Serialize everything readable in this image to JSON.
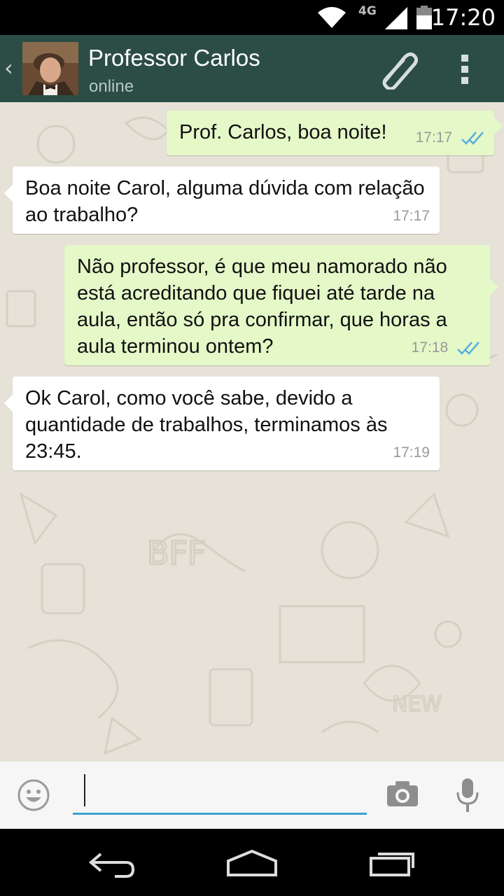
{
  "status_bar": {
    "network": "4G",
    "time": "17:20"
  },
  "header": {
    "back_icon": "chevron-left-icon",
    "contact_name": "Professor Carlos",
    "contact_status": "online",
    "attach_icon": "paperclip-icon",
    "menu_icon": "overflow-menu-icon"
  },
  "messages": [
    {
      "direction": "out",
      "text": "Prof. Carlos, boa noite!",
      "time": "17:17",
      "status": "read"
    },
    {
      "direction": "in",
      "text": "Boa noite Carol, alguma dúvida com relação ao trabalho?",
      "time": "17:17"
    },
    {
      "direction": "out",
      "text": "Não professor, é que meu namorado não está acreditando que fiquei até tarde na aula, então só pra confirmar, que horas a aula terminou ontem?",
      "time": "17:18",
      "status": "read"
    },
    {
      "direction": "in",
      "text": "Ok Carol, como você sabe, devido a quantidade de trabalhos, terminamos às 23:45.",
      "time": "17:19"
    }
  ],
  "input_bar": {
    "message_value": "",
    "emoji_icon": "emoji-icon",
    "camera_icon": "camera-icon",
    "mic_icon": "microphone-icon"
  },
  "colors": {
    "action_bar": "#2b4d45",
    "outgoing_bubble": "#e4f8c8",
    "incoming_bubble": "#ffffff",
    "read_ticks": "#5aaee0",
    "input_underline": "#3aa0cf",
    "chat_background": "#e6e2d8"
  }
}
